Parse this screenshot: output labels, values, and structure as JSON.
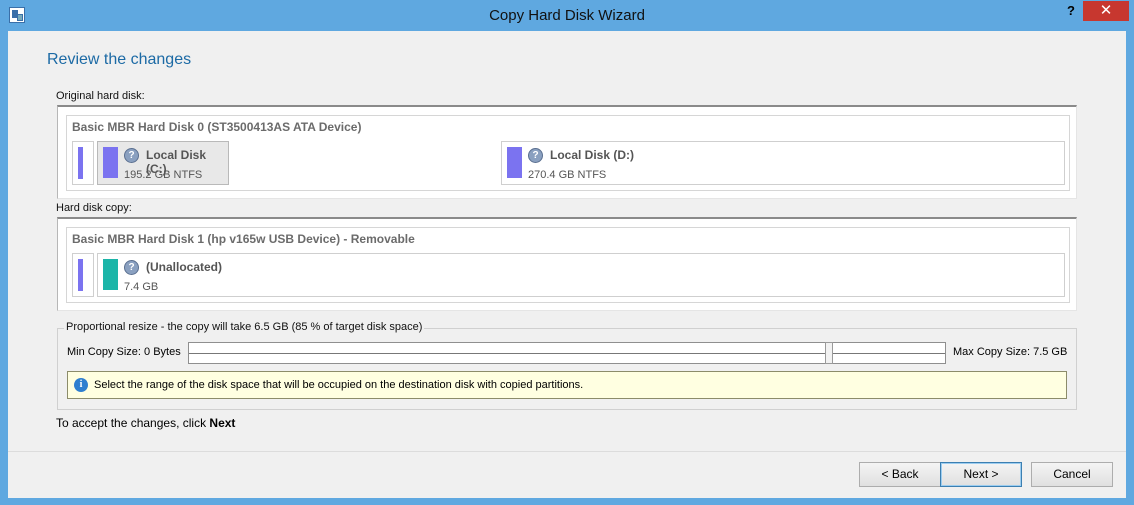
{
  "window": {
    "title": "Copy Hard Disk Wizard",
    "help_label": "?",
    "close_label": "✕"
  },
  "page": {
    "heading": "Review the changes"
  },
  "original": {
    "label": "Original hard disk:",
    "disk_name": "Basic MBR Hard Disk 0 (ST3500413AS ATA Device)",
    "partitions": [
      {
        "name": "Local Disk (C:)",
        "size": "195.2 GB NTFS",
        "color": "#7b73f0"
      },
      {
        "name": "Local Disk (D:)",
        "size": "270.4 GB NTFS",
        "color": "#7b73f0"
      }
    ]
  },
  "copy": {
    "label": "Hard disk copy:",
    "disk_name": "Basic MBR Hard Disk 1 (hp v165w USB Device) - Removable",
    "partitions": [
      {
        "name": "(Unallocated)",
        "size": "7.4 GB",
        "color": "#1bb5a8"
      }
    ]
  },
  "resize": {
    "legend": "Proportional resize - the copy will take 6.5 GB (85 % of target disk space)",
    "min_label": "Min Copy Size:   0 Bytes",
    "max_label": "Max Copy Size:   7.5 GB",
    "slider_value_percent": 85,
    "info_icon": "i",
    "info_text": "Select the range of the disk space that will be occupied on the destination disk with copied partitions."
  },
  "accept": {
    "prefix": "To accept the changes, click ",
    "action": "Next"
  },
  "buttons": {
    "back": "< Back",
    "next": "Next >",
    "cancel": "Cancel"
  },
  "icons": {
    "partition_status": "?"
  }
}
